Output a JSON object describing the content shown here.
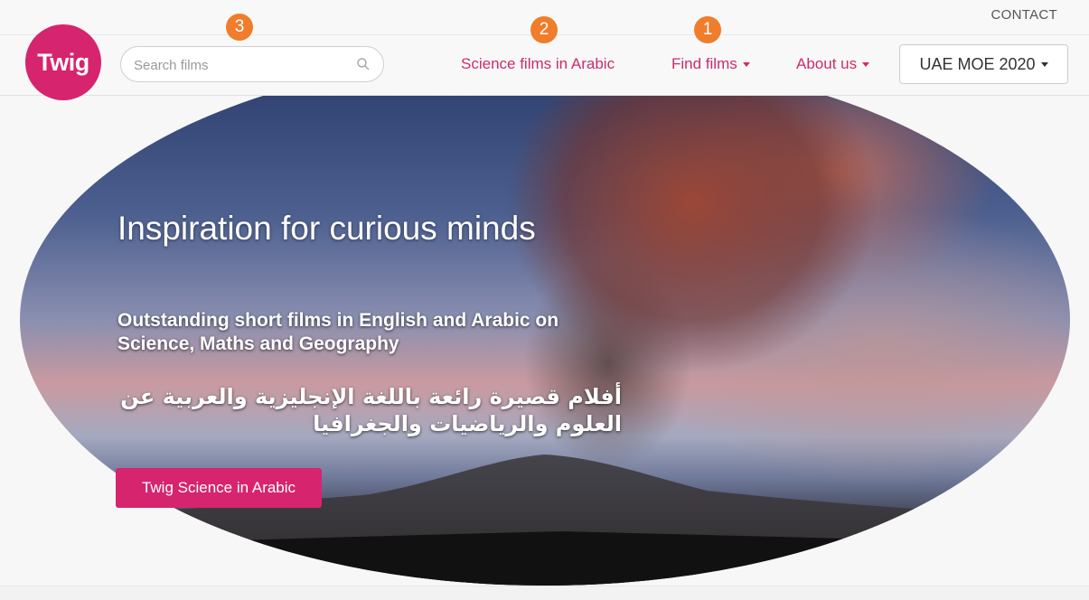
{
  "header": {
    "contact_label": "CONTACT",
    "logo_text": "Twig",
    "search": {
      "placeholder": "Search films",
      "value": ""
    },
    "nav": {
      "science_arabic": "Science films in Arabic",
      "find_films": "Find films",
      "about_us": "About us",
      "uae": "UAE MOE 2020"
    }
  },
  "badges": {
    "one": "1",
    "two": "2",
    "three": "3"
  },
  "hero": {
    "title": "Inspiration for curious minds",
    "subtitle": "Outstanding short films in English and Arabic on Science, Maths and Geography",
    "arabic_text": "أفلام قصيرة رائعة باللغة الإنجليزية والعربية عن العلوم والرياضيات والجغرافيا",
    "cta_label": "Twig Science in Arabic"
  },
  "colors": {
    "brand": "#d6246e",
    "badge": "#ef7d2b",
    "link": "#cc2c6b"
  }
}
